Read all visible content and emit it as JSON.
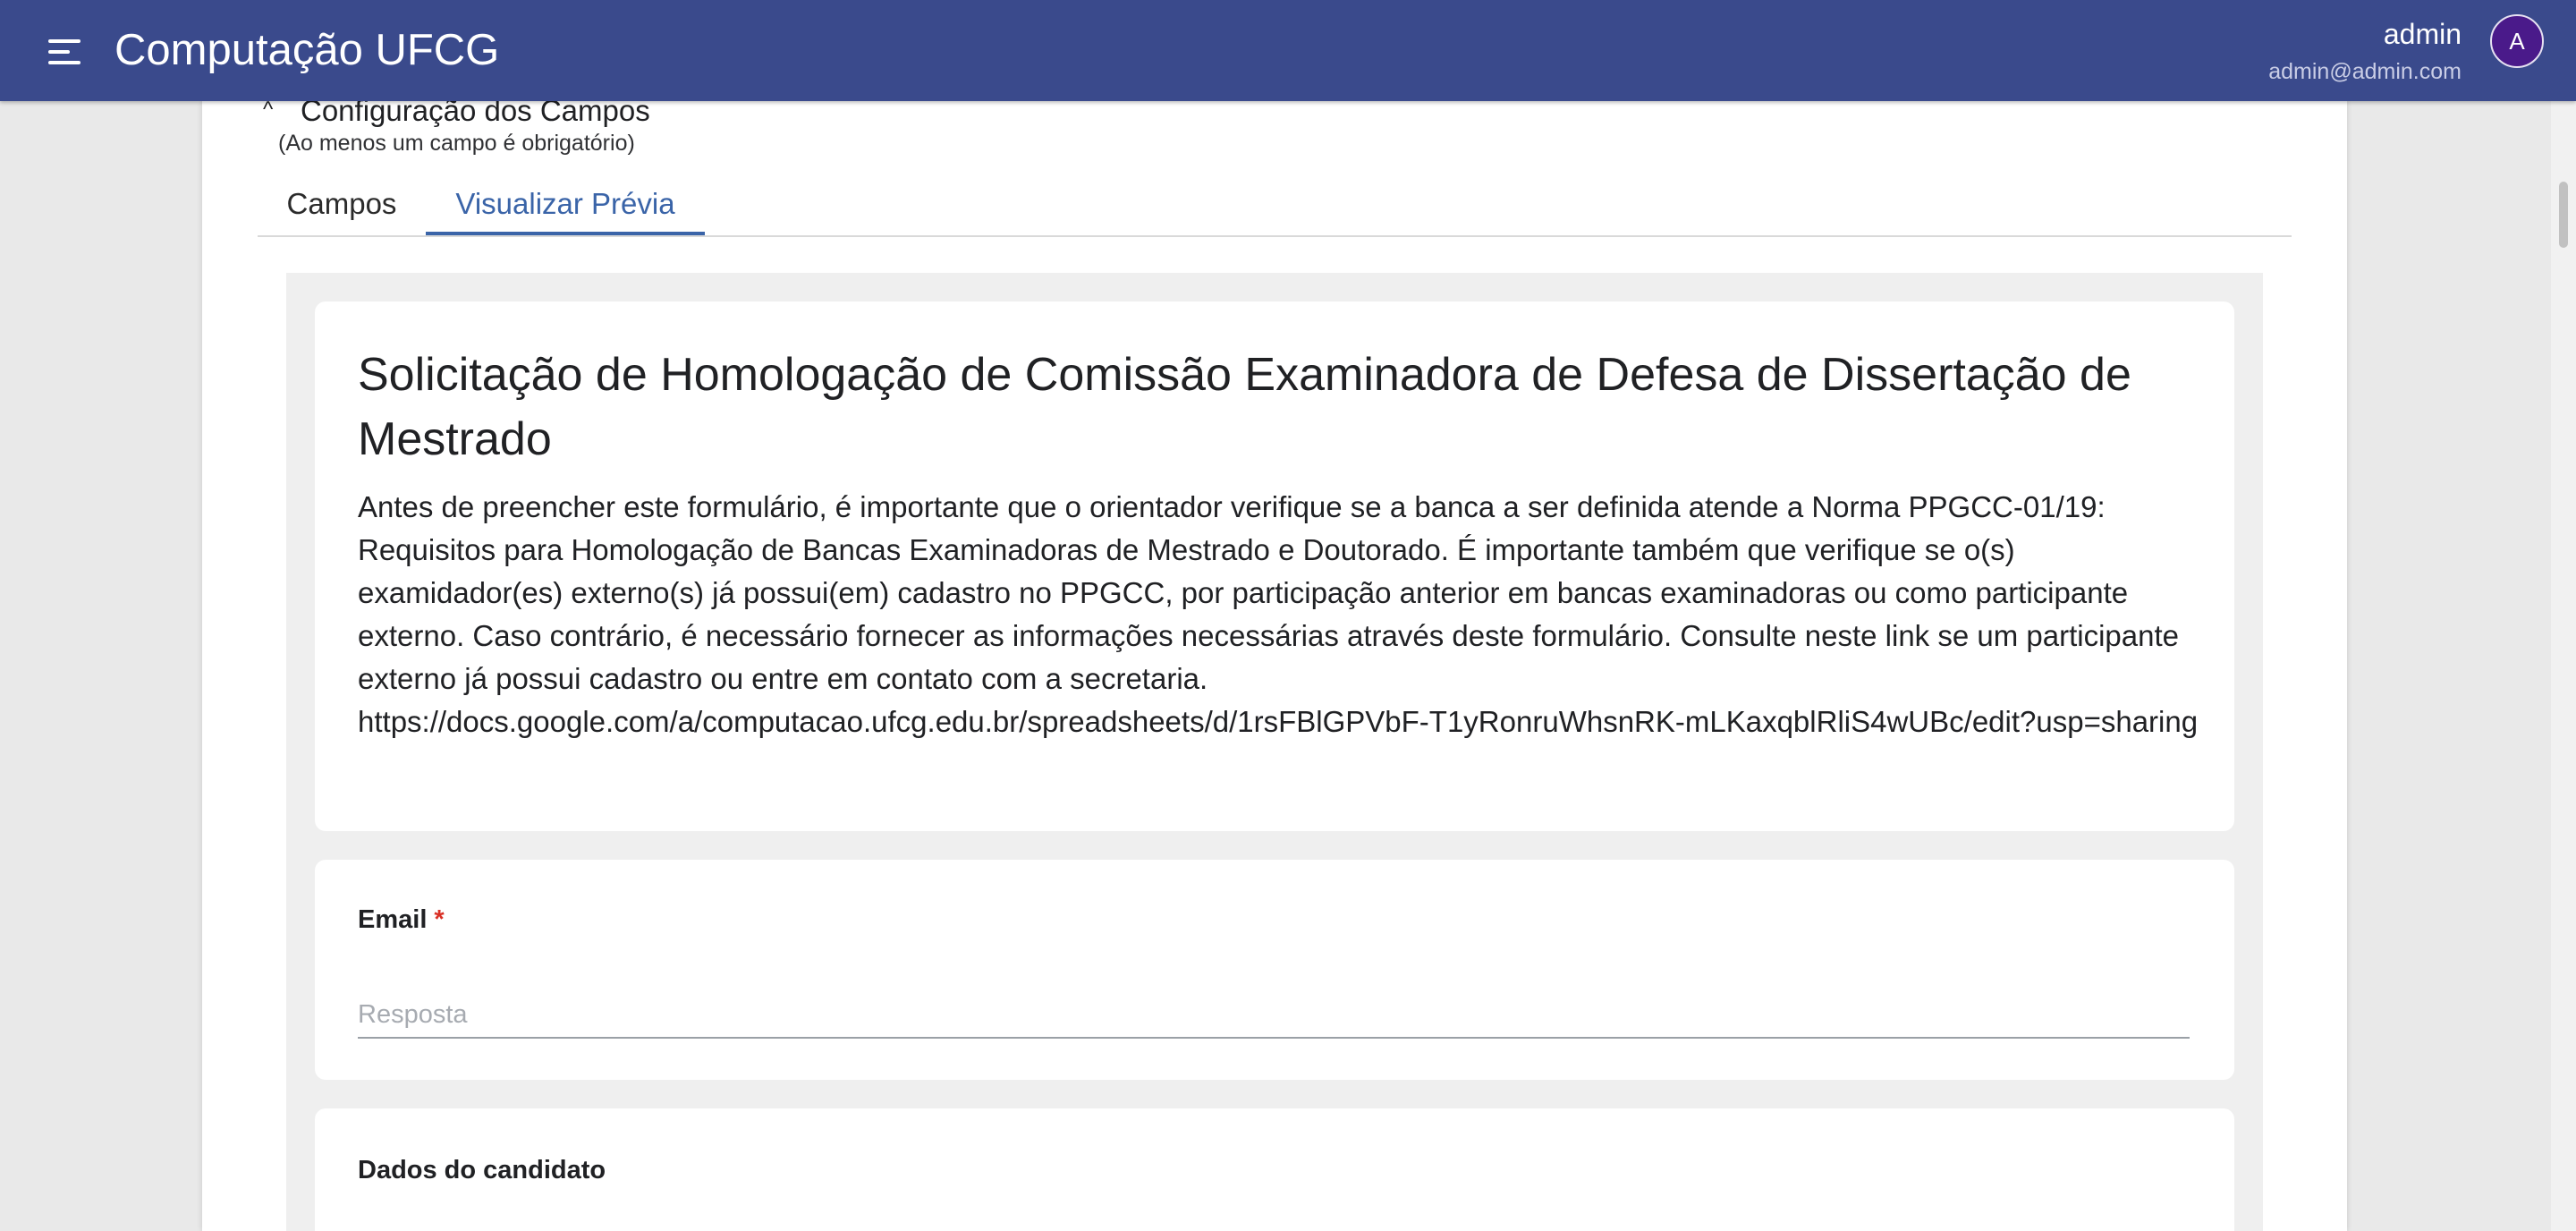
{
  "app": {
    "title": "Computação UFCG",
    "user_name": "admin",
    "user_email": "admin@admin.com",
    "avatar_initial": "A"
  },
  "section": {
    "title": "Configuração dos Campos",
    "subtitle": "(Ao menos um campo é obrigatório)"
  },
  "tabs": [
    {
      "label": "Campos",
      "active": false
    },
    {
      "label": "Visualizar Prévia",
      "active": true
    }
  ],
  "form": {
    "title": "Solicitação de Homologação de Comissão Examinadora de Defesa de Dissertação de Mestrado",
    "description": "Antes de preencher este formulário, é importante que o orientador verifique se a banca a ser definida atende a Norma PPGCC-01/19: Requisitos para Homologação de Bancas Examinadoras de Mestrado e Doutorado. É importante também que verifique se o(s) examidador(es) externo(s) já possui(em) cadastro no PPGCC, por participação anterior em bancas examinadoras ou como participante externo. Caso contrário, é necessário fornecer as informações necessárias através deste formulário. Consulte neste link se um participante externo já possui cadastro ou entre em contato com a secretaria.",
    "link": "https://docs.google.com/a/computacao.ufcg.edu.br/spreadsheets/d/1rsFBlGPVbF-T1yRonruWhsnRK-mLKaxqblRliS4wUBc/edit?usp=sharing",
    "fields": [
      {
        "label": "Email",
        "required_mark": "*",
        "placeholder": "Resposta",
        "value": ""
      },
      {
        "label": "Dados do candidato"
      }
    ]
  },
  "colors": {
    "appbar": "#3a4a8c",
    "accent": "#3a64a8",
    "avatar": "#4a1a8a",
    "required": "#d93025"
  }
}
